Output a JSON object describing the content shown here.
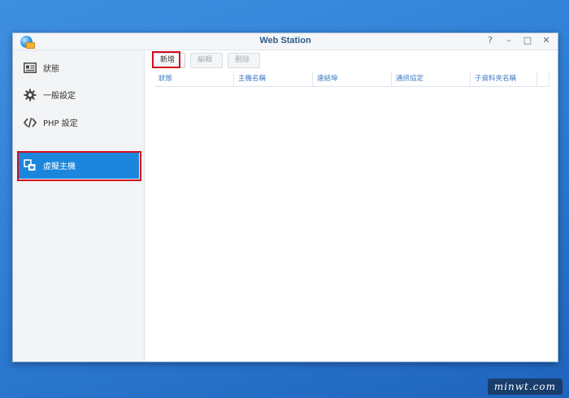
{
  "window": {
    "title": "Web Station",
    "controls": [
      {
        "name": "help-icon",
        "glyph": "?"
      },
      {
        "name": "minimize-icon",
        "glyph": "–"
      },
      {
        "name": "maximize-icon",
        "glyph": "□"
      },
      {
        "name": "close-icon",
        "glyph": "✕"
      }
    ]
  },
  "sidebar": {
    "items": [
      {
        "label": "狀態",
        "icon": "status-card-icon"
      },
      {
        "label": "一般設定",
        "icon": "gear-icon"
      },
      {
        "label": "PHP 設定",
        "icon": "code-icon"
      },
      {
        "label": "虛擬主機",
        "icon": "virtual-host-icon",
        "active": true
      }
    ]
  },
  "toolbar": {
    "new_label": "新增",
    "edit_label": "編輯",
    "delete_label": "刪除"
  },
  "table": {
    "columns": [
      "狀態",
      "主機名稱",
      "連結埠",
      "通訊協定",
      "子資料夾名稱"
    ]
  },
  "watermark": "minwt.com",
  "colors": {
    "accent": "#1b86dc",
    "highlight": "#d40c1c",
    "header_text": "#3c78c0"
  }
}
